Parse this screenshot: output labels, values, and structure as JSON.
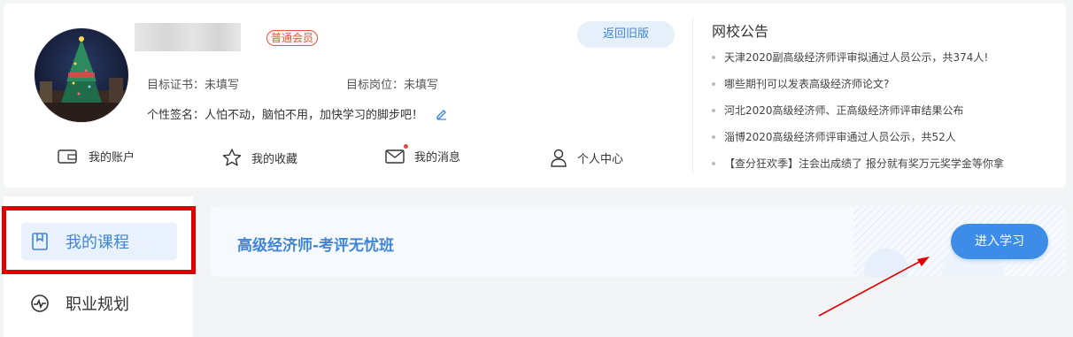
{
  "profile": {
    "badge": "普通会员",
    "back_button": "返回旧版",
    "target_cert_label": "目标证书：",
    "target_cert_value": "未填写",
    "target_post_label": "目标岗位：",
    "target_post_value": "未填写",
    "signature_label": "个性签名：",
    "signature_value": "人怕不动，脑怕不用，加快学习的脚步吧！"
  },
  "quick_nav": [
    {
      "label": "我的账户",
      "icon": "wallet-icon"
    },
    {
      "label": "我的收藏",
      "icon": "star-icon"
    },
    {
      "label": "我的消息",
      "icon": "mail-icon"
    },
    {
      "label": "个人中心",
      "icon": "user-icon"
    }
  ],
  "notice": {
    "title": "网校公告",
    "items": [
      "天津2020副高级经济师评审拟通过人员公示，共374人!",
      "哪些期刊可以发表高级经济师论文?",
      "河北2020高级经济师、正高级经济师评审结果公布",
      "淄博2020高级经济师评审通过人员公示，共52人",
      "【查分狂欢季】注会出成绩了 报分就有奖万元奖学金等你拿"
    ]
  },
  "sidebar": {
    "items": [
      {
        "label": "我的课程",
        "icon": "bookmark-icon"
      },
      {
        "label": "职业规划",
        "icon": "activity-icon"
      }
    ]
  },
  "course": {
    "title": "高级经济师-考评无忧班",
    "enter_button": "进入学习"
  },
  "colors": {
    "accent": "#3f86d6",
    "button": "#3d8de8",
    "badge": "#e2583e",
    "highlight_box": "#e10000"
  }
}
